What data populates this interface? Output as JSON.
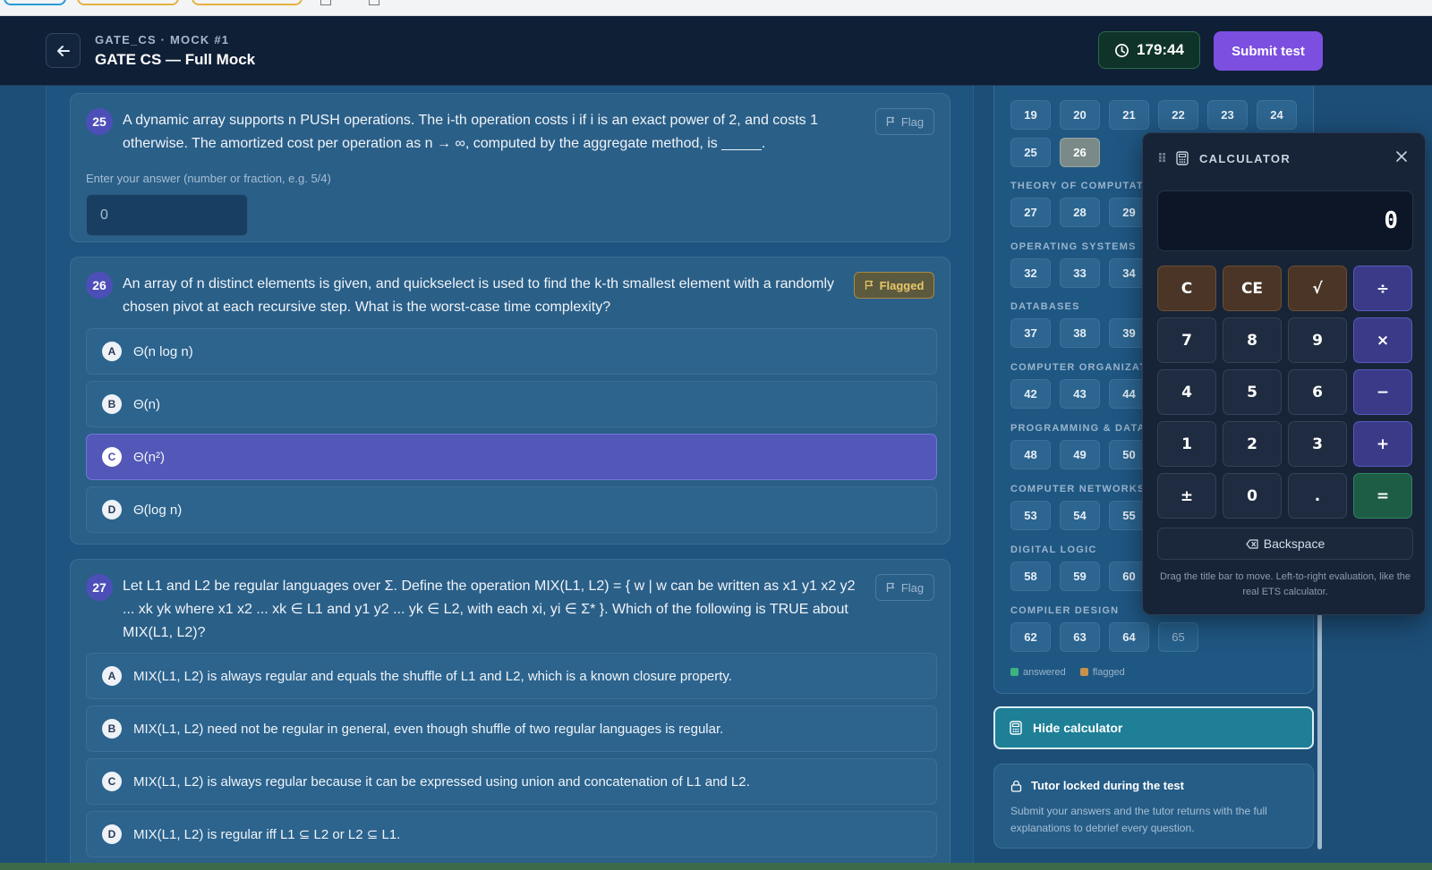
{
  "header": {
    "crumb": "GATE_CS · MOCK #1",
    "title": "GATE CS — Full Mock",
    "timer": "179:44",
    "submit_label": "Submit test"
  },
  "questions": [
    {
      "number": "25",
      "text": "A dynamic array supports n PUSH operations. The i-th operation costs i if i is an exact power of 2, and costs 1 otherwise. The amortized cost per operation as n → ∞, computed by the aggregate method, is _____.",
      "flag_label": "Flag",
      "hint": "Enter your answer (number or fraction, e.g. 5/4)",
      "answer_value": "0"
    },
    {
      "number": "26",
      "text": "An array of n distinct elements is given, and quickselect is used to find the k-th smallest element with a randomly chosen pivot at each recursive step. What is the worst-case time complexity?",
      "flag_label": "Flagged",
      "options": [
        {
          "letter": "A",
          "text": "Θ(n log n)"
        },
        {
          "letter": "B",
          "text": "Θ(n)"
        },
        {
          "letter": "C",
          "text": "Θ(n²)"
        },
        {
          "letter": "D",
          "text": "Θ(log n)"
        }
      ],
      "selected": "C"
    },
    {
      "number": "27",
      "text": "Let L1 and L2 be regular languages over Σ. Define the operation MIX(L1, L2) = { w | w can be written as x1 y1 x2 y2 ... xk yk where x1 x2 ... xk ∈ L1 and y1 y2 ... yk ∈ L2, with each xi, yi ∈ Σ* }. Which of the following is TRUE about MIX(L1, L2)?",
      "flag_label": "Flag",
      "options": [
        {
          "letter": "A",
          "text": "MIX(L1, L2) is always regular and equals the shuffle of L1 and L2, which is a known closure property."
        },
        {
          "letter": "B",
          "text": "MIX(L1, L2) need not be regular in general, even though shuffle of two regular languages is regular."
        },
        {
          "letter": "C",
          "text": "MIX(L1, L2) is always regular because it can be expressed using union and concatenation of L1 and L2."
        },
        {
          "letter": "D",
          "text": "MIX(L1, L2) is regular iff L1 ⊆ L2 or L2 ⊆ L1."
        }
      ]
    }
  ],
  "palette": {
    "top_rows": [
      [
        "19",
        "20",
        "21",
        "22",
        "23",
        "24"
      ],
      [
        "25",
        "26"
      ]
    ],
    "current": "26",
    "sections": [
      {
        "label": "THEORY OF COMPUTATI",
        "numbers": [
          "27",
          "28",
          "29"
        ]
      },
      {
        "label": "OPERATING SYSTEMS",
        "numbers": [
          "32",
          "33",
          "34"
        ]
      },
      {
        "label": "DATABASES",
        "numbers": [
          "37",
          "38",
          "39"
        ]
      },
      {
        "label": "COMPUTER ORGANIZAT",
        "numbers": [
          "42",
          "43",
          "44"
        ]
      },
      {
        "label": "PROGRAMMING & DATA",
        "numbers": [
          "48",
          "49",
          "50"
        ]
      },
      {
        "label": "COMPUTER NETWORKS",
        "numbers": [
          "53",
          "54",
          "55"
        ]
      },
      {
        "label": "DIGITAL LOGIC",
        "numbers": [
          "58",
          "59",
          "60"
        ]
      },
      {
        "label": "COMPILER DESIGN",
        "numbers": [
          "62",
          "63",
          "64",
          "65"
        ]
      }
    ],
    "legend": {
      "answered": "answered",
      "flagged": "flagged"
    }
  },
  "hide_calculator_label": "Hide calculator",
  "tutor": {
    "title": "Tutor locked during the test",
    "body": "Submit your answers and the tutor returns with the full explanations to debrief every question."
  },
  "calculator": {
    "title": "CALCULATOR",
    "display": "0",
    "keys": [
      {
        "label": "C",
        "kind": "clr"
      },
      {
        "label": "CE",
        "kind": "clr"
      },
      {
        "label": "√",
        "kind": "clr"
      },
      {
        "label": "÷",
        "kind": "op"
      },
      {
        "label": "7",
        "kind": "num"
      },
      {
        "label": "8",
        "kind": "num"
      },
      {
        "label": "9",
        "kind": "num"
      },
      {
        "label": "×",
        "kind": "op"
      },
      {
        "label": "4",
        "kind": "num"
      },
      {
        "label": "5",
        "kind": "num"
      },
      {
        "label": "6",
        "kind": "num"
      },
      {
        "label": "−",
        "kind": "op"
      },
      {
        "label": "1",
        "kind": "num"
      },
      {
        "label": "2",
        "kind": "num"
      },
      {
        "label": "3",
        "kind": "num"
      },
      {
        "label": "+",
        "kind": "op"
      },
      {
        "label": "±",
        "kind": "num"
      },
      {
        "label": "0",
        "kind": "num"
      },
      {
        "label": ".",
        "kind": "num"
      },
      {
        "label": "=",
        "kind": "eq"
      }
    ],
    "backspace_label": "Backspace",
    "note": "Drag the title bar to move. Left-to-right evaluation, like the real ETS calculator."
  },
  "colors": {
    "accent": "#7c4fe0",
    "selected_option": "#5358b8",
    "answered": "#3fb37f",
    "flagged": "#c7924a"
  }
}
